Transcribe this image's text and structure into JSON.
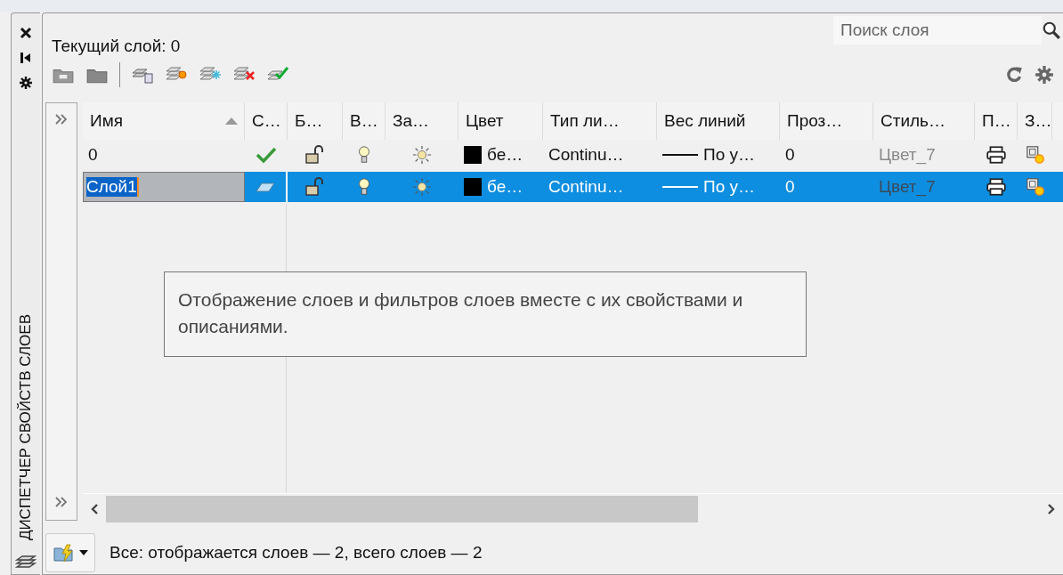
{
  "side_title": "ДИСПЕТЧЕР СВОЙСТВ СЛОЕВ",
  "current_layer": "Текущий слой: 0",
  "search": {
    "placeholder": "Поиск слоя"
  },
  "columns": [
    {
      "label": "Имя",
      "sorted": true
    },
    {
      "label": "С…",
      "sorted": false
    },
    {
      "label": "Б…",
      "sorted": false
    },
    {
      "label": "В…",
      "sorted": false
    },
    {
      "label": "За…",
      "sorted": false
    },
    {
      "label": "Цвет",
      "sorted": false
    },
    {
      "label": "Тип ли…",
      "sorted": false
    },
    {
      "label": "Вес линий",
      "sorted": false
    },
    {
      "label": "Проз…",
      "sorted": false
    },
    {
      "label": "Стиль…",
      "sorted": false
    },
    {
      "label": "П…",
      "sorted": false
    },
    {
      "label": "З…",
      "sorted": false
    }
  ],
  "rows": [
    {
      "name": "0",
      "selected": false,
      "current": true,
      "locked": false,
      "on": true,
      "frozen": false,
      "color_name": "бе…",
      "linetype": "Continu…",
      "lineweight": "По у…",
      "transparency": "0",
      "plot_style": "Цвет_7",
      "plot": true
    },
    {
      "name": "Слой1",
      "selected": true,
      "current": false,
      "locked": false,
      "on": true,
      "frozen": false,
      "color_name": "бе…",
      "linetype": "Continu…",
      "lineweight": "По у…",
      "transparency": "0",
      "plot_style": "Цвет_7",
      "plot": true
    }
  ],
  "tooltip": "Отображение слоев и фильтров слоев вместе с их свойствами и описаниями.",
  "status": "Все: отображается слоев — 2, всего слоев — 2"
}
